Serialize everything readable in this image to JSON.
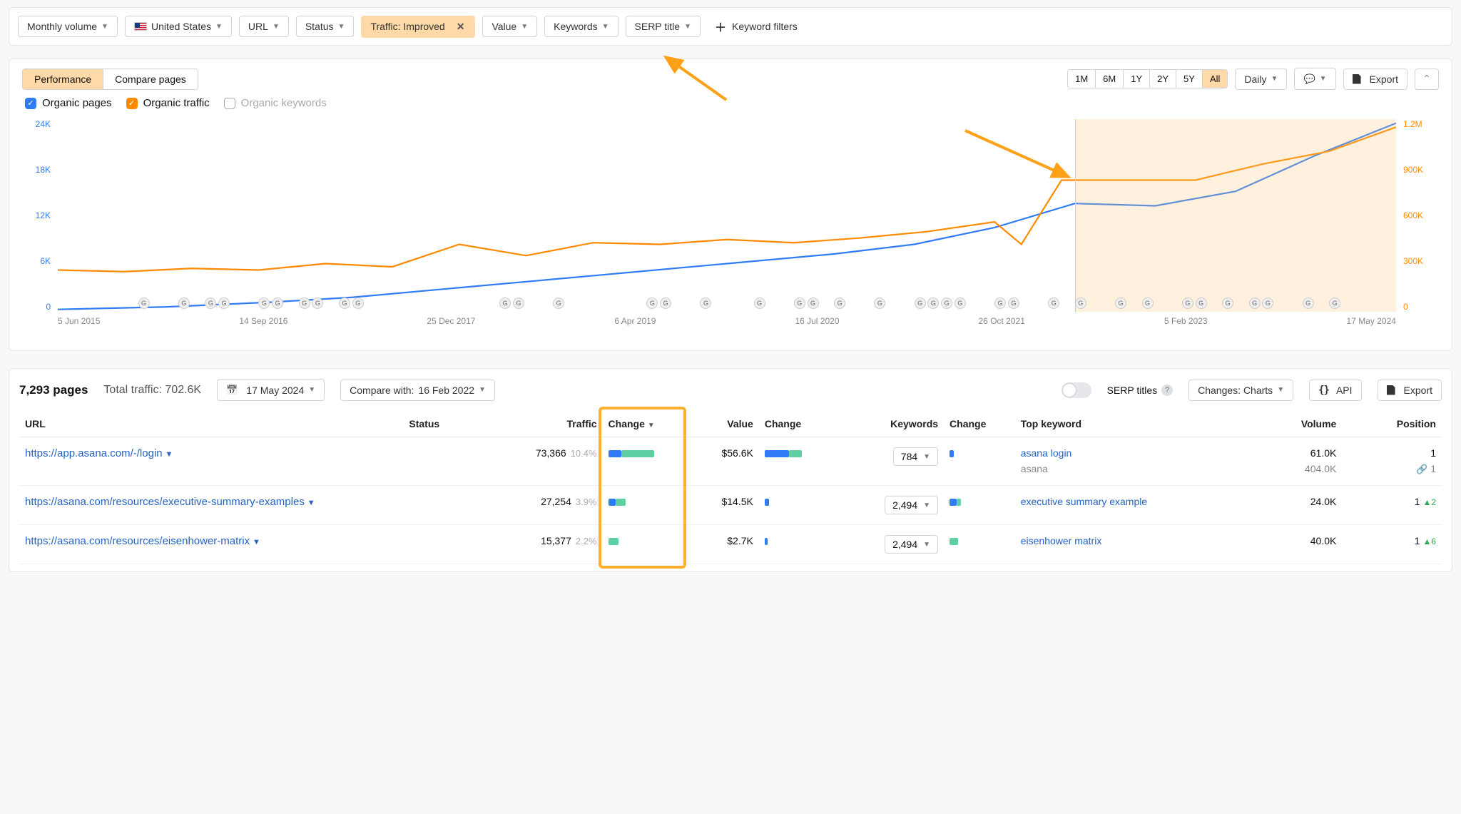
{
  "filters": {
    "monthly_volume": "Monthly volume",
    "country": "United States",
    "url": "URL",
    "status": "Status",
    "traffic_chip": "Traffic: Improved",
    "value": "Value",
    "keywords": "Keywords",
    "serp_title": "SERP title",
    "keyword_filters": "Keyword filters"
  },
  "chart_panel": {
    "tabs": {
      "performance": "Performance",
      "compare": "Compare pages"
    },
    "ranges": [
      "1M",
      "6M",
      "1Y",
      "2Y",
      "5Y",
      "All"
    ],
    "range_active": "All",
    "granularity": "Daily",
    "export": "Export",
    "legend": {
      "organic_pages": "Organic pages",
      "organic_traffic": "Organic traffic",
      "organic_keywords": "Organic keywords"
    }
  },
  "chart_data": {
    "type": "line",
    "x_labels": [
      "5 Jun 2015",
      "14 Sep 2016",
      "25 Dec 2017",
      "6 Apr 2019",
      "16 Jul 2020",
      "26 Oct 2021",
      "5 Feb 2023",
      "17 May 2024"
    ],
    "left_axis": {
      "label": "Organic pages",
      "ticks": [
        "24K",
        "18K",
        "12K",
        "6K",
        "0"
      ],
      "color": "#2f7cf6"
    },
    "right_axis": {
      "label": "Organic traffic",
      "ticks": [
        "1.2M",
        "900K",
        "600K",
        "300K",
        "0"
      ],
      "color": "#ff8a00"
    },
    "series": [
      {
        "name": "Organic pages",
        "axis": "left",
        "color": "#2f7cf6",
        "x": [
          0,
          0.08,
          0.16,
          0.22,
          0.3,
          0.4,
          0.5,
          0.58,
          0.64,
          0.7,
          0.76,
          0.82,
          0.88,
          0.94,
          1.0
        ],
        "y": [
          300,
          600,
          1200,
          1800,
          3000,
          4500,
          6000,
          7200,
          8400,
          10500,
          13500,
          13200,
          15000,
          19500,
          23500
        ]
      },
      {
        "name": "Organic traffic",
        "axis": "right",
        "color": "#ff8a00",
        "x": [
          0,
          0.05,
          0.1,
          0.15,
          0.2,
          0.25,
          0.3,
          0.35,
          0.4,
          0.45,
          0.5,
          0.55,
          0.6,
          0.65,
          0.7,
          0.72,
          0.75,
          0.8,
          0.85,
          0.9,
          0.95,
          1.0
        ],
        "y": [
          260000,
          250000,
          270000,
          260000,
          300000,
          280000,
          420000,
          350000,
          430000,
          420000,
          450000,
          430000,
          460000,
          500000,
          560000,
          420000,
          820000,
          820000,
          820000,
          920000,
          1000000,
          1150000
        ]
      }
    ],
    "highlight": {
      "x_start_frac": 0.76,
      "x_end_frac": 1.0
    },
    "ylim_left": [
      0,
      24000
    ],
    "ylim_right": [
      0,
      1200000
    ]
  },
  "table_header": {
    "pages_count": "7,293",
    "pages_label": "pages",
    "total_traffic_label": "Total traffic:",
    "total_traffic": "702.6K",
    "date": "17 May 2024",
    "compare_label": "Compare with:",
    "compare_date": "16 Feb 2022",
    "serp_titles": "SERP titles",
    "changes_label": "Changes: Charts",
    "api": "API",
    "export": "Export"
  },
  "columns": {
    "url": "URL",
    "status": "Status",
    "traffic": "Traffic",
    "change1": "Change",
    "value": "Value",
    "change2": "Change",
    "keywords": "Keywords",
    "change3": "Change",
    "top_keyword": "Top keyword",
    "volume": "Volume",
    "position": "Position"
  },
  "rows": [
    {
      "url": "https://app.asana.com/-/login",
      "traffic": "73,366",
      "traffic_pct": "10.4%",
      "value": "$56.6K",
      "keywords": "784",
      "top_keywords": [
        {
          "kw": "asana login",
          "vol": "61.0K",
          "pos": "1",
          "pos_delta": ""
        },
        {
          "kw": "asana",
          "vol": "404.0K",
          "pos": "1",
          "pos_delta": "",
          "linked": true
        }
      ],
      "bars": {
        "change1_blue": 18,
        "change1_green": 46,
        "change2_blue": 34,
        "change2_green": 18,
        "change3_blue": 6
      }
    },
    {
      "url": "https://asana.com/resources/executive-summary-examples",
      "traffic": "27,254",
      "traffic_pct": "3.9%",
      "value": "$14.5K",
      "keywords": "2,494",
      "top_keywords": [
        {
          "kw": "executive summary example",
          "vol": "24.0K",
          "pos": "1",
          "pos_delta": "▲2"
        }
      ],
      "bars": {
        "change1_blue": 10,
        "change1_green": 14,
        "change2_blue": 6,
        "change2_green": 0,
        "change3_blue": 10,
        "change3_green": 6
      }
    },
    {
      "url": "https://asana.com/resources/eisenhower-matrix",
      "traffic": "15,377",
      "traffic_pct": "2.2%",
      "value": "$2.7K",
      "keywords": "2,494",
      "top_keywords": [
        {
          "kw": "eisenhower matrix",
          "vol": "40.0K",
          "pos": "1",
          "pos_delta": "▲6"
        }
      ],
      "bars": {
        "change1_green": 14,
        "change2_blue": 4,
        "change3_green": 12
      }
    }
  ]
}
